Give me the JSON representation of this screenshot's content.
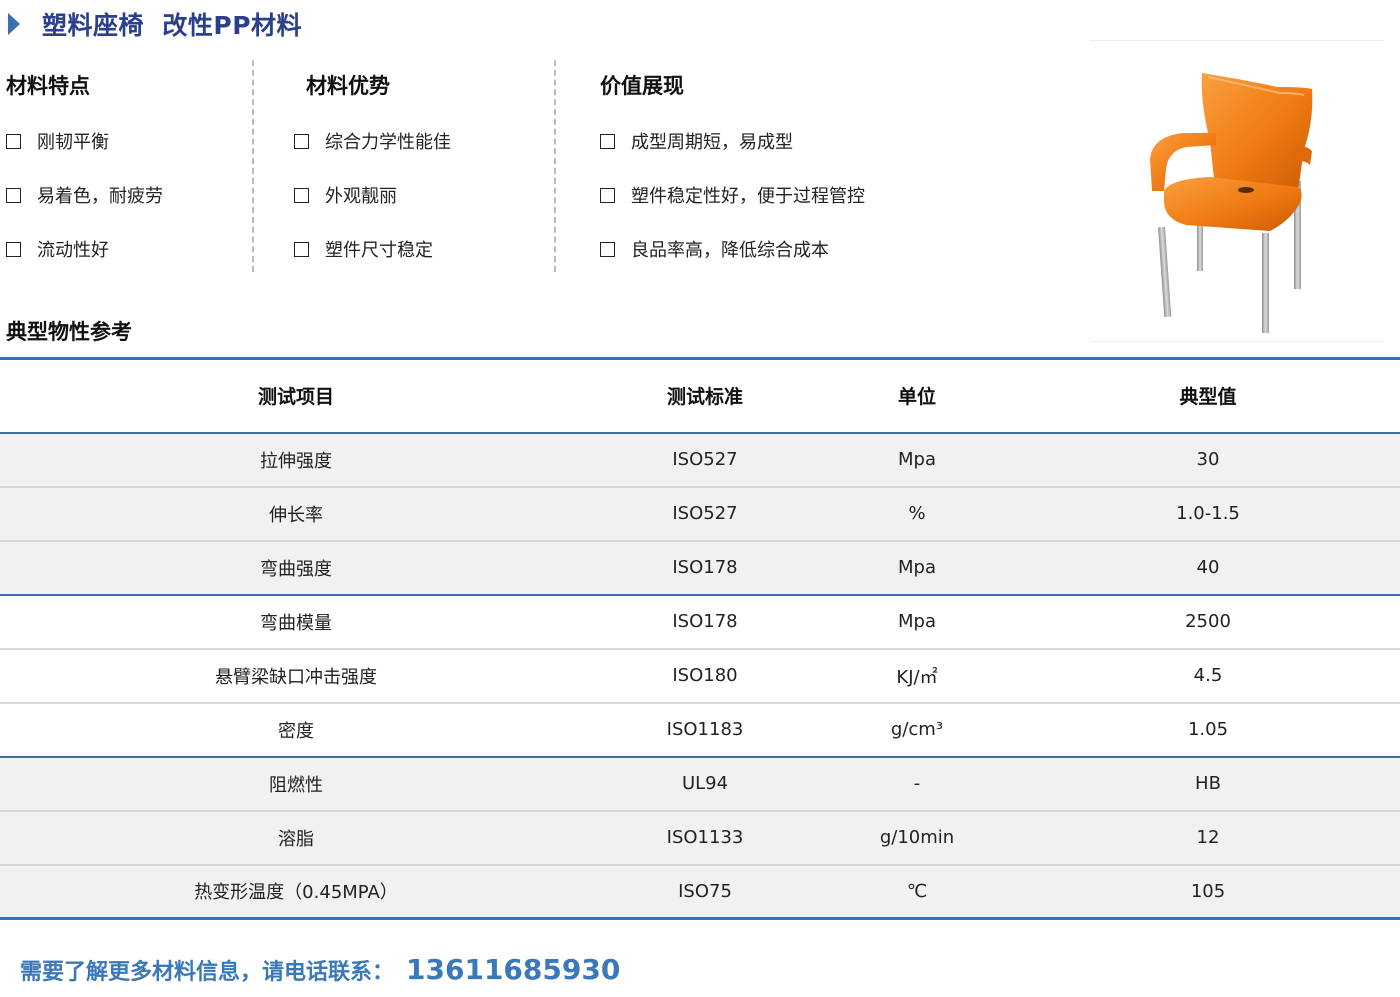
{
  "header": {
    "title": "塑料座椅  改性PP材料"
  },
  "columns": [
    {
      "title": "材料特点",
      "items": [
        "刚韧平衡",
        "易着色，耐疲劳",
        "流动性好"
      ]
    },
    {
      "title": "材料优势",
      "items": [
        "综合力学性能佳",
        "外观靓丽",
        "塑件尺寸稳定"
      ]
    },
    {
      "title": "价值展现",
      "items": [
        "成型周期短，易成型",
        "塑件稳定性好，便于过程管控",
        "良品率高，降低综合成本"
      ]
    }
  ],
  "product_image": {
    "subject": "orange-plastic-armchair",
    "seat_color": "#f07a12",
    "leg_color": "#b8b8b8"
  },
  "properties": {
    "title": "典型物性参考",
    "headers": [
      "测试项目",
      "测试标准",
      "单位",
      "典型值"
    ],
    "rows": [
      [
        "拉伸强度",
        "ISO527",
        "Mpa",
        "30"
      ],
      [
        "伸长率",
        "ISO527",
        "%",
        "1.0-1.5"
      ],
      [
        "弯曲强度",
        "ISO178",
        "Mpa",
        "40"
      ],
      [
        "弯曲模量",
        "ISO178",
        "Mpa",
        "2500"
      ],
      [
        "悬臂梁缺口冲击强度",
        "ISO180",
        "KJ/㎡",
        "4.5"
      ],
      [
        "密度",
        "ISO1183",
        "g/cm³",
        "1.05"
      ],
      [
        "阻燃性",
        "UL94",
        "-",
        "HB"
      ],
      [
        "溶脂",
        "ISO1133",
        "g/10min",
        "12"
      ],
      [
        "热变形温度（0.45MPA）",
        "ISO75",
        "℃",
        "105"
      ]
    ]
  },
  "contact": {
    "label": "需要了解更多材料信息，请电话联系：",
    "phone": "13611685930"
  },
  "colors": {
    "accent": "#3a6fb0",
    "title": "#2b3f8f",
    "contact": "#3a78b8",
    "row_shade": "#f1f1f1"
  }
}
